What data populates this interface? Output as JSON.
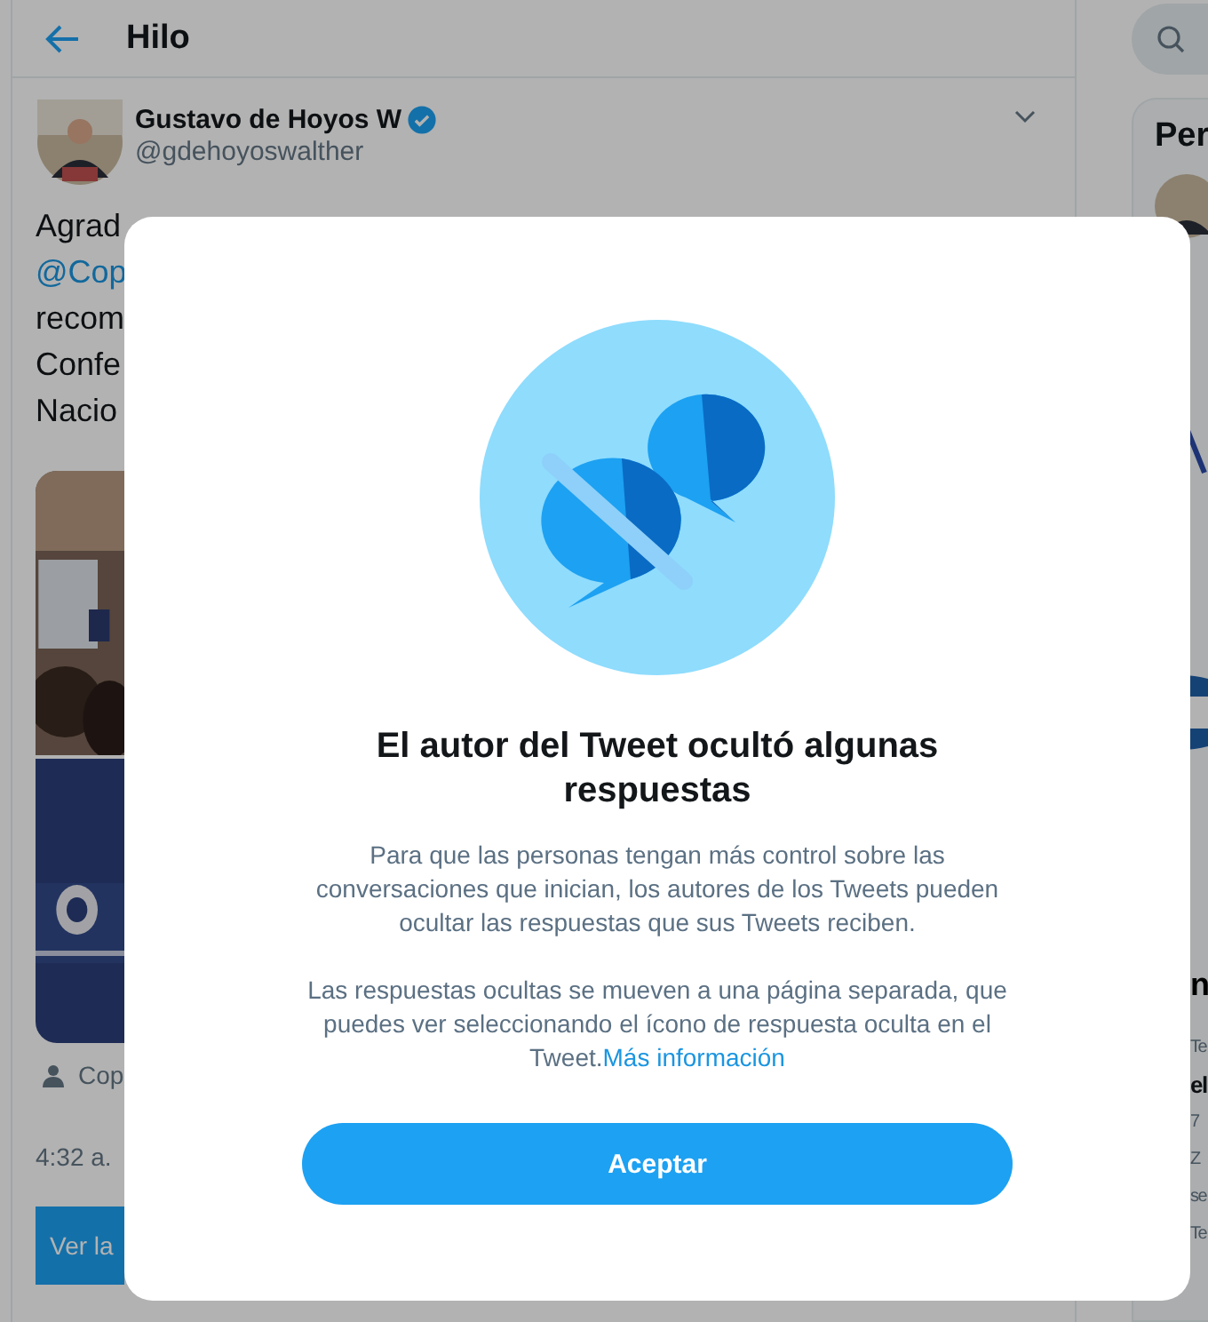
{
  "header": {
    "title": "Hilo"
  },
  "tweet": {
    "author": "Gustavo de Hoyos W",
    "handle": "@gdehoyoswalther",
    "verified": true,
    "text_lines": [
      {
        "text": "Agrad",
        "kind": "plain"
      },
      {
        "text": "@Cop",
        "kind": "mention"
      },
      {
        "text": "recom",
        "kind": "plain"
      },
      {
        "text": "Confe",
        "kind": "plain"
      },
      {
        "text": "Nacio",
        "kind": "plain"
      }
    ],
    "tagged": "Cop",
    "time": "4:32 a.",
    "action": "Ver la"
  },
  "sidebar": {
    "card_title": "Per",
    "trends": [
      {
        "text": "Te",
        "kind": "meta"
      },
      {
        "text": "el",
        "kind": "title"
      },
      {
        "text": "7",
        "kind": "meta"
      },
      {
        "text": "Z",
        "kind": "meta"
      },
      {
        "text": "se",
        "kind": "meta"
      },
      {
        "text": "Te",
        "kind": "meta"
      }
    ],
    "section_title": "n"
  },
  "dialog": {
    "title": "El autor del Tweet ocultó algunas respuestas",
    "paragraphs": [
      "Para que las personas tengan más control sobre las conversaciones que inician, los autores de los Tweets pueden ocultar las respuestas que sus Tweets reciben.",
      "Las respuestas ocultas se mueven a una página separada, que puedes ver seleccionando el ícono de respuesta oculta en el Tweet."
    ],
    "link": "Más información",
    "button": "Aceptar"
  }
}
